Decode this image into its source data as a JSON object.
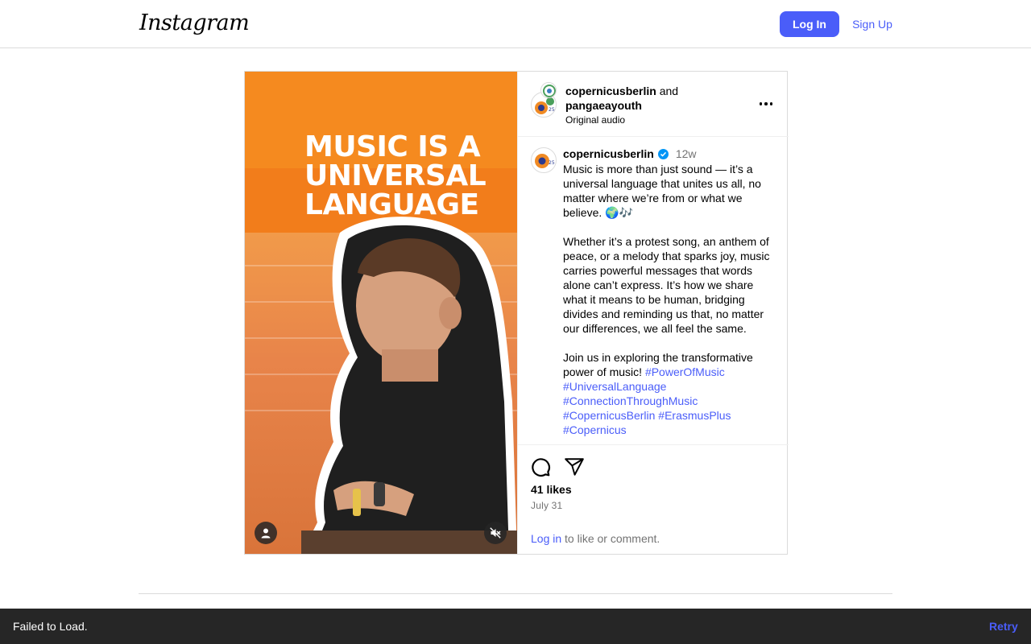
{
  "header": {
    "logo_text": "Instagram",
    "login_label": "Log In",
    "signup_label": "Sign Up"
  },
  "post": {
    "media": {
      "headline_lines": [
        "MUSIC IS A",
        "UNIVERSAL",
        "LANGUAGE"
      ],
      "profile_icon": "person-icon",
      "mute_icon": "muted-speaker-icon"
    },
    "author_line": {
      "user1": "copernicusberlin",
      "conjunction": "and",
      "user2": "pangaeayouth",
      "audio": "Original audio"
    },
    "caption": {
      "username": "copernicusberlin",
      "verified": true,
      "time": "12w",
      "text": "Music is more than just sound — it’s a universal language that unites us all, no matter where we’re from or what we believe. 🌍🎶\n\nWhether it’s a protest song, an anthem of peace, or a melody that sparks joy, music carries powerful messages that words alone can’t express. It’s how we share what it means to be human, bridging divides and reminding us that, no matter our differences, we all feel the same.\n\nJoin us in exploring the transformative power of music! ",
      "hashtags": [
        "#PowerOfMusic",
        "#UniversalLanguage",
        "#ConnectionThroughMusic",
        "#CopernicusBerlin",
        "#ErasmusPlus",
        "#Copernicus"
      ]
    },
    "likes": "41 likes",
    "date": "July 31",
    "login_prompt": {
      "link": "Log in",
      "rest": " to like or comment."
    }
  },
  "toast": {
    "message": "Failed to Load.",
    "retry_label": "Retry"
  },
  "colors": {
    "accent": "#4a5df9",
    "media_orange": "#f27d1b",
    "toast_bg": "#262626"
  }
}
